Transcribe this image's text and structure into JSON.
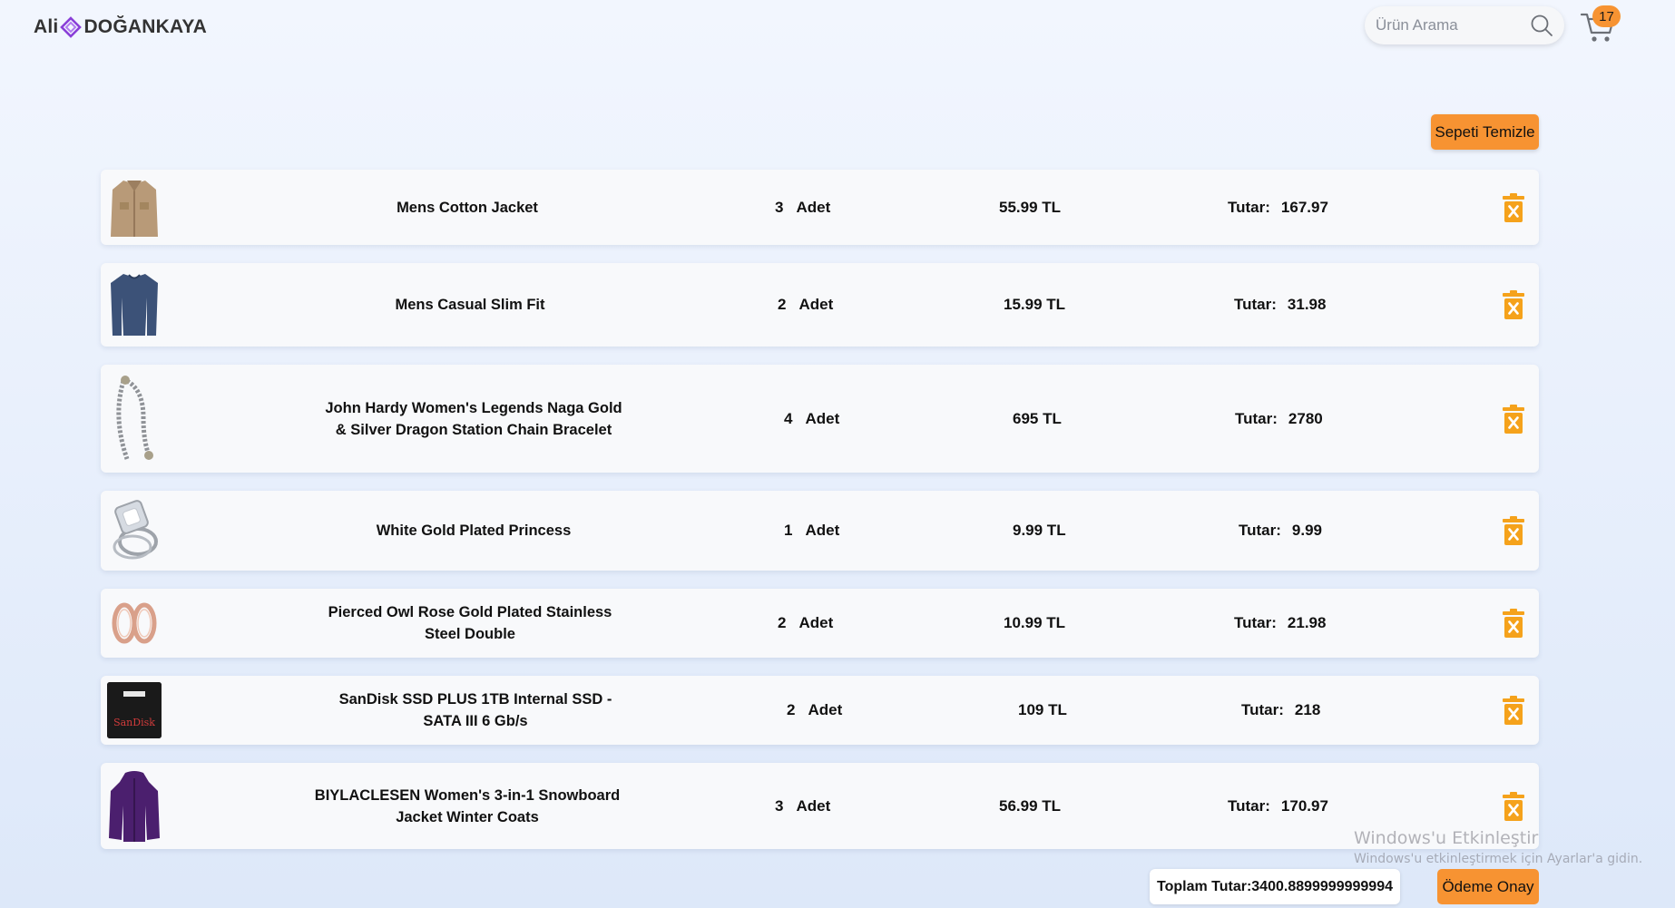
{
  "header": {
    "logo_left": "Ali",
    "logo_right": "DOĞANKAYA",
    "search_placeholder": "Ürün Arama",
    "cart_count": "17"
  },
  "actions": {
    "clear_cart_label": "Sepeti Temizle",
    "confirm_payment_label": "Ödeme Onay"
  },
  "cart": {
    "qty_unit": "Adet",
    "total_label": "Tutar:",
    "items": [
      {
        "name": "Mens Cotton Jacket",
        "qty": "3",
        "price": "55.99 TL",
        "total": "167.97",
        "image": "jacket-image"
      },
      {
        "name": "Mens Casual Slim Fit",
        "qty": "2",
        "price": "15.99 TL",
        "total": "31.98",
        "image": "shirt-image"
      },
      {
        "name": "John Hardy Women's Legends Naga Gold & Silver Dragon Station Chain Bracelet",
        "qty": "4",
        "price": "695 TL",
        "total": "2780",
        "image": "bracelet-image"
      },
      {
        "name": "White Gold Plated Princess",
        "qty": "1",
        "price": "9.99 TL",
        "total": "9.99",
        "image": "ring-image"
      },
      {
        "name": "Pierced Owl Rose Gold Plated Stainless Steel Double",
        "qty": "2",
        "price": "10.99 TL",
        "total": "21.98",
        "image": "rose-gold-rings-image"
      },
      {
        "name": "SanDisk SSD PLUS 1TB Internal SSD - SATA III 6 Gb/s",
        "qty": "2",
        "price": "109 TL",
        "total": "218",
        "image": "ssd-image"
      },
      {
        "name": "BIYLACLESEN Women's 3-in-1 Snowboard Jacket Winter Coats",
        "qty": "3",
        "price": "56.99 TL",
        "total": "170.97",
        "image": "purple-jacket-image"
      }
    ],
    "grand_total": "Toplam Tutar:3400.8899999999994"
  },
  "watermark": {
    "title": "Windows'u Etkinleştir",
    "subtitle": "Windows'u etkinleştirmek için Ayarlar'a gidin."
  },
  "colors": {
    "accent": "#f79332",
    "trash": "#f5a21b",
    "logo_diamond": "#8a3fd8"
  }
}
